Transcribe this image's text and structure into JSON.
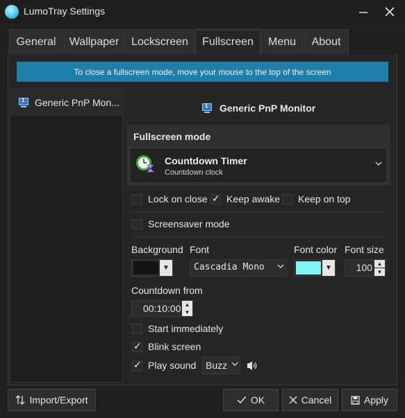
{
  "window": {
    "title": "LumoTray Settings",
    "minimize_glyph": "—",
    "close_glyph": "✕"
  },
  "tabs": [
    {
      "label": "General"
    },
    {
      "label": "Wallpaper"
    },
    {
      "label": "Lockscreen"
    },
    {
      "label": "Fullscreen",
      "active": true
    },
    {
      "label": "Menu"
    },
    {
      "label": "About"
    }
  ],
  "banner": "To close a fullscreen mode, move your mouse to the top of the screen",
  "monitor_list": {
    "items": [
      {
        "label": "Generic PnP Mon..."
      }
    ]
  },
  "monitor_title": "Generic PnP Monitor",
  "fullscreen_mode": {
    "heading": "Fullscreen mode",
    "selected_name": "Countdown Timer",
    "selected_desc": "Countdown clock",
    "icon": "clock-hourglass-icon"
  },
  "options": {
    "lock_on_close": {
      "label": "Lock on close",
      "checked": false
    },
    "keep_awake": {
      "label": "Keep awake",
      "checked": true
    },
    "keep_on_top": {
      "label": "Keep on top",
      "checked": false
    },
    "screensaver_mode": {
      "label": "Screensaver mode",
      "checked": false
    }
  },
  "appearance": {
    "background_label": "Background",
    "background_color": "#141414",
    "font_label": "Font",
    "font_value": "Cascadia Mono",
    "font_color_label": "Font color",
    "font_color": "#7ff6f6",
    "font_size_label": "Font size",
    "font_size_value": "100"
  },
  "countdown": {
    "label": "Countdown from",
    "value": "00:10:00"
  },
  "behavior": {
    "start_immediately": {
      "label": "Start immediately",
      "checked": false
    },
    "blink_screen": {
      "label": "Blink screen",
      "checked": true
    },
    "play_sound": {
      "label": "Play sound",
      "checked": true
    },
    "sound_value": "Buzz"
  },
  "footer": {
    "import_export": "Import/Export",
    "ok": "OK",
    "cancel": "Cancel",
    "apply": "Apply"
  },
  "colors": {
    "accent_banner": "#1f7fa8",
    "background": "#202020"
  }
}
